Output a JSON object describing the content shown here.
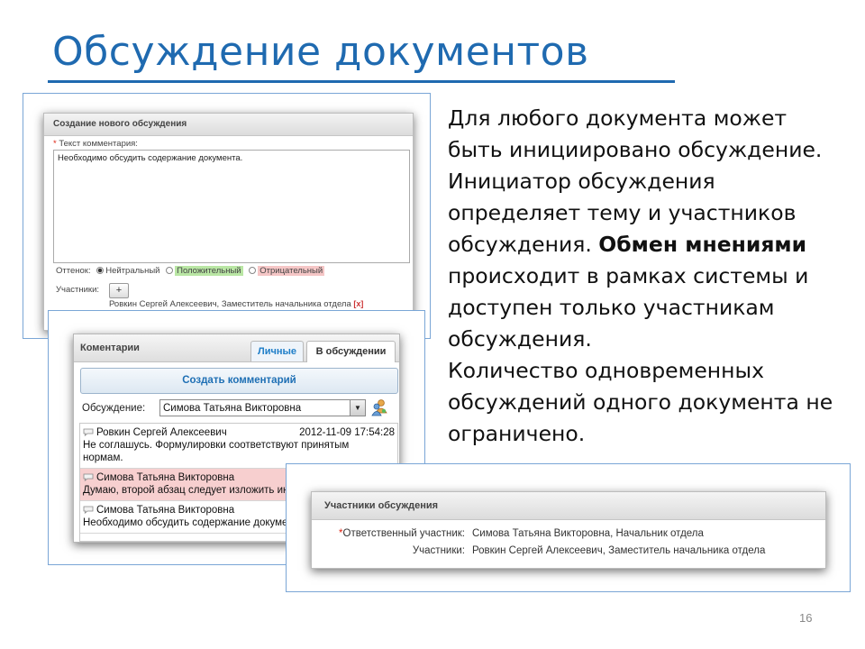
{
  "slide": {
    "title": "Обсуждение документов",
    "page_number": "16",
    "body_lines": [
      "Для любого документа может",
      "быть инициировано обсуждение.",
      "Инициатор обсуждения",
      "определяет тему и участников",
      "обсуждения. ",
      "Обмен мнениями",
      "происходит в рамках системы и",
      "доступен только участникам",
      "обсуждения.",
      "Количество одновременных",
      "обсуждений одного документа не",
      "ограничено."
    ]
  },
  "new_discussion": {
    "header": "Создание нового обсуждения",
    "comment_label_req": "*",
    "comment_label": " Текст комментария:",
    "comment_text": "Необходимо обсудить содержание документа.",
    "tone_label": "Оттенок:",
    "tone_options": [
      "Нейтральный",
      "Положительный",
      "Отрицательный"
    ],
    "tone_selected": "Нейтральный",
    "participants_label": "Участники:",
    "add_button": "+",
    "participant": "Ровкин Сергей Алексеевич, Заместитель начальника отдела",
    "remove_label": "[x]"
  },
  "comments_panel": {
    "title": "Коментарии",
    "tabs": [
      "Личные",
      "В обсуждении"
    ],
    "active_tab": "В обсуждении",
    "create_button": "Создать комментарий",
    "discussion_label": "Обсуждение:",
    "discussion_value": "Симова Татьяна Викторовна",
    "comments": [
      {
        "author": "Ровкин Сергей Алексеевич",
        "date": "2012-11-09 17:54:28",
        "text": "Не соглашусь. Формулировки соответствуют принятым",
        "text2": "нормам.",
        "highlight": false
      },
      {
        "author": "Симова Татьяна Викторовна",
        "date": "",
        "text": "Думаю, второй абзац следует изложить иначе",
        "text2": "",
        "highlight": true
      },
      {
        "author": "Симова Татьяна Викторовна",
        "date": "",
        "text": "Необходимо обсудить содержание документа.",
        "text2": "",
        "highlight": false
      }
    ],
    "colors": {
      "tab_link": "#1e7ec8",
      "highlight": "#f7cfcf"
    }
  },
  "participants_panel": {
    "title": "Участники обсуждения",
    "responsible_req": "*",
    "responsible_label": "Ответственный участник:",
    "responsible_value": "Симова Татьяна Викторовна, Начальник отдела",
    "participants_label": "Участники:",
    "participants_value": "Ровкин Сергей Алексеевич, Заместитель начальника отдела"
  },
  "colors": {
    "title": "#1f6ab0",
    "frame_border": "#7aa6d6"
  }
}
